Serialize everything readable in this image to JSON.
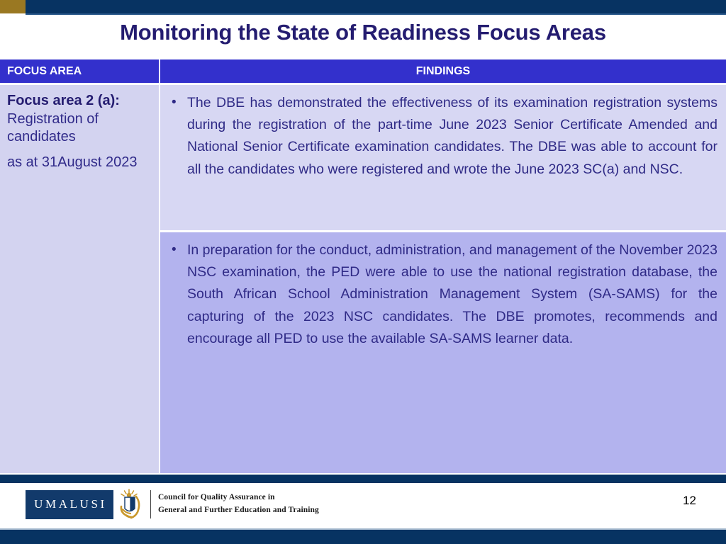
{
  "slide": {
    "title": "Monitoring the State of Readiness Focus Areas",
    "page_number": "12",
    "colors": {
      "title_text": "#241c70",
      "header_bar_top_navy": "#073362",
      "header_bar_top_gold": "#9a7822",
      "table_header_blue": "#3330cc",
      "cell_left_bg": "#d3d3f0",
      "cell_findings_row1_bg": "#d7d7f3",
      "cell_findings_row2_bg": "#b3b3ee",
      "body_text": "#2f2a86"
    }
  },
  "table": {
    "headers": {
      "focus_area": "FOCUS AREA",
      "findings": "FINDINGS"
    },
    "focus_area": {
      "label": "Focus area 2 (a):",
      "description": " Registration of candidates",
      "as_at": "as at 31August 2023"
    },
    "findings": [
      {
        "bullet": "•",
        "text": "The DBE has demonstrated the effectiveness of its examination registration systems during the registration of the part-time June 2023 Senior Certificate Amended and National  Senior Certificate examination candidates. The DBE was able to account for all the candidates who were registered and wrote the June 2023 SC(a) and NSC."
      },
      {
        "bullet": "•",
        "text": "In preparation for the conduct, administration, and management of the November 2023 NSC examination, the PED were able to use the national registration database, the South African School Administration Management System (SA-SAMS) for the capturing of the 2023 NSC candidates. The DBE promotes, recommends and encourage all PED to use the available SA-SAMS learner data."
      }
    ]
  },
  "footer": {
    "logo_wordmark": "UMALUSI",
    "tagline_line1": "Council for Quality Assurance in",
    "tagline_line2": "General and Further Education and Training"
  }
}
